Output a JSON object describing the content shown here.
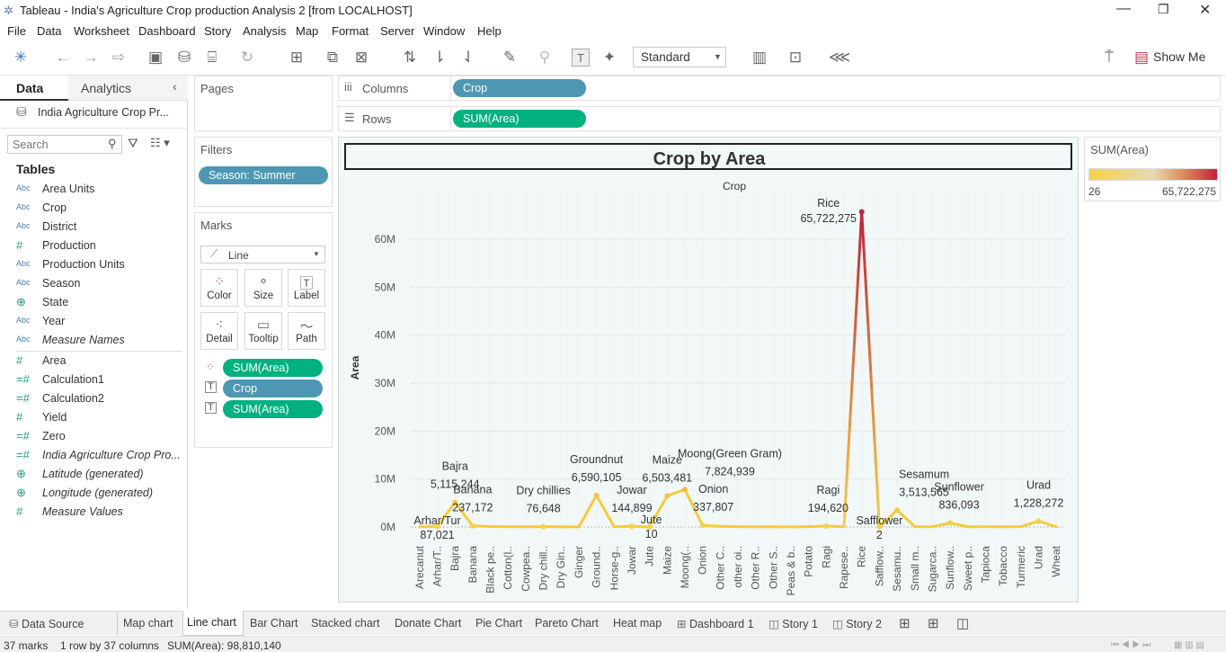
{
  "window": {
    "title": "Tableau - India's Agriculture Crop production Analysis 2 [from LOCALHOST]"
  },
  "menu": [
    "File",
    "Data",
    "Worksheet",
    "Dashboard",
    "Story",
    "Analysis",
    "Map",
    "Format",
    "Server",
    "Window",
    "Help"
  ],
  "toolbar": {
    "fit_select": "Standard",
    "show_me": "Show Me"
  },
  "left": {
    "tab_data": "Data",
    "tab_analytics": "Analytics",
    "datasource": "India Agriculture Crop Pr...",
    "search_placeholder": "Search",
    "tables_heading": "Tables",
    "dimensions": [
      {
        "icon": "Abc",
        "label": "Area Units",
        "italic": false
      },
      {
        "icon": "Abc",
        "label": "Crop",
        "italic": false
      },
      {
        "icon": "Abc",
        "label": "District",
        "italic": false
      },
      {
        "icon": "#",
        "label": "Production",
        "italic": false
      },
      {
        "icon": "Abc",
        "label": "Production Units",
        "italic": false
      },
      {
        "icon": "Abc",
        "label": "Season",
        "italic": false
      },
      {
        "icon": "globe",
        "label": "State",
        "italic": false
      },
      {
        "icon": "Abc",
        "label": "Year",
        "italic": false
      },
      {
        "icon": "Abc",
        "label": "Measure Names",
        "italic": true
      }
    ],
    "measures": [
      {
        "icon": "#",
        "label": "Area",
        "italic": false
      },
      {
        "icon": "=#",
        "label": "Calculation1",
        "italic": false
      },
      {
        "icon": "=#",
        "label": "Calculation2",
        "italic": false
      },
      {
        "icon": "#",
        "label": "Yield",
        "italic": false
      },
      {
        "icon": "=#",
        "label": "Zero",
        "italic": false
      },
      {
        "icon": "=#",
        "label": "India Agriculture Crop Pro...",
        "italic": true
      },
      {
        "icon": "globe",
        "label": "Latitude (generated)",
        "italic": true
      },
      {
        "icon": "globe",
        "label": "Longitude (generated)",
        "italic": true
      },
      {
        "icon": "#",
        "label": "Measure Values",
        "italic": true
      }
    ]
  },
  "shelves": {
    "pages": "Pages",
    "columns_label": "Columns",
    "columns_pill": "Crop",
    "rows_label": "Rows",
    "rows_pill": "SUM(Area)"
  },
  "filters": {
    "title": "Filters",
    "pill": "Season: Summer"
  },
  "marks": {
    "title": "Marks",
    "type": "Line",
    "buttons": [
      "Color",
      "Size",
      "Label",
      "Detail",
      "Tooltip",
      "Path"
    ],
    "pills": [
      {
        "text": "SUM(Area)",
        "color": "green"
      },
      {
        "text": "Crop",
        "color": "blue"
      },
      {
        "text": "SUM(Area)",
        "color": "green"
      }
    ]
  },
  "legend": {
    "title": "SUM(Area)",
    "min": "26",
    "max": "65,722,275"
  },
  "chart_data": {
    "type": "line",
    "title": "Crop by Area",
    "xlabel": "Crop",
    "ylabel": "Area",
    "yticks": [
      "0M",
      "10M",
      "20M",
      "30M",
      "40M",
      "50M",
      "60M"
    ],
    "ylim": [
      0,
      70000000
    ],
    "grid": true,
    "color_gradient": [
      "#f5d24a",
      "#c0233c"
    ],
    "categories": [
      "Arecanut",
      "Arhar/T..",
      "Bajra",
      "Banana",
      "Black pe..",
      "Cotton(l..",
      "Cowpea..",
      "Dry chill..",
      "Dry Gin..",
      "Ginger",
      "Ground..",
      "Horse-g..",
      "Jowar",
      "Jute",
      "Maize",
      "Moong(..",
      "Onion",
      "Other C..",
      "other oi..",
      "Other R..",
      "Other S..",
      "Peas & b..",
      "Potato",
      "Ragi",
      "Rapese..",
      "Rice",
      "Safflow..",
      "Sesamu..",
      "Small m..",
      "Sugarca..",
      "Sunflow..",
      "Sweet p..",
      "Tapioca",
      "Tobacco",
      "Turmeric",
      "Urad",
      "Wheat"
    ],
    "values": [
      50000,
      87021,
      5115244,
      237172,
      100000,
      60000,
      50000,
      76648,
      40000,
      30000,
      6590105,
      50000,
      144899,
      10,
      6503481,
      7824939,
      337807,
      150000,
      80000,
      50000,
      40000,
      30000,
      60000,
      194620,
      50000,
      65722275,
      2,
      3513565,
      80000,
      50000,
      836093,
      50000,
      60000,
      40000,
      70000,
      1228272,
      50000
    ],
    "labels": [
      {
        "i": 1,
        "name": "Arhar/Tur",
        "value": "87,021"
      },
      {
        "i": 2,
        "name": "Bajra",
        "value": "5,115,244"
      },
      {
        "i": 3,
        "name": "Banana",
        "value": "237,172"
      },
      {
        "i": 7,
        "name": "Dry chillies",
        "value": "76,648"
      },
      {
        "i": 10,
        "name": "Groundnut",
        "value": "6,590,105"
      },
      {
        "i": 12,
        "name": "Jowar",
        "value": "144,899"
      },
      {
        "i": 13,
        "name": "Jute",
        "value": "10"
      },
      {
        "i": 14,
        "name": "Maize",
        "value": "6,503,481"
      },
      {
        "i": 15,
        "name": "Moong(Green Gram)",
        "value": "7,824,939"
      },
      {
        "i": 16,
        "name": "Onion",
        "value": "337,807"
      },
      {
        "i": 23,
        "name": "Ragi",
        "value": "194,620"
      },
      {
        "i": 25,
        "name": "Rice",
        "value": "65,722,275"
      },
      {
        "i": 26,
        "name": "Safflower",
        "value": "2"
      },
      {
        "i": 27,
        "name": "Sesamum",
        "value": "3,513,565"
      },
      {
        "i": 30,
        "name": "Sunflower",
        "value": "836,093"
      },
      {
        "i": 35,
        "name": "Urad",
        "value": "1,228,272"
      }
    ]
  },
  "sheets": [
    "Data Source",
    "Map chart",
    "Line chart",
    "Bar Chart",
    "Stacked chart",
    "Donate Chart",
    "Pie Chart",
    "Pareto Chart",
    "Heat map",
    "Dashboard 1",
    "Story 1",
    "Story 2"
  ],
  "active_sheet": "Line chart",
  "status": {
    "marks": "37 marks",
    "dims": "1 row by 37 columns",
    "sum": "SUM(Area): 98,810,140"
  }
}
